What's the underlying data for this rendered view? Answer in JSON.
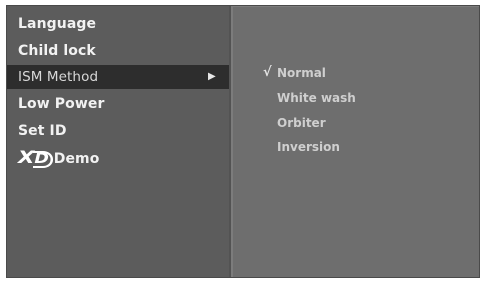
{
  "menu": {
    "items": [
      {
        "label": "Language"
      },
      {
        "label": "Child lock"
      },
      {
        "label": "ISM Method"
      },
      {
        "label": "Low Power"
      },
      {
        "label": "Set ID"
      },
      {
        "label": "Demo",
        "logo_text_x": "X",
        "logo_text_d": "D"
      }
    ],
    "selected_index": 2,
    "arrow_icon": "right-triangle-icon"
  },
  "submenu": {
    "check_icon": "checkmark-icon",
    "check_glyph": "√",
    "items": [
      {
        "label": "Normal",
        "checked": true
      },
      {
        "label": "White wash",
        "checked": false
      },
      {
        "label": "Orbiter",
        "checked": false
      },
      {
        "label": "Inversion",
        "checked": false
      }
    ]
  },
  "colors": {
    "screen_bg": "#6c6c6c",
    "left_panel_bg": "#5c5c5c",
    "selected_bg": "#2d2d2d",
    "text": "#f2f2f2"
  }
}
